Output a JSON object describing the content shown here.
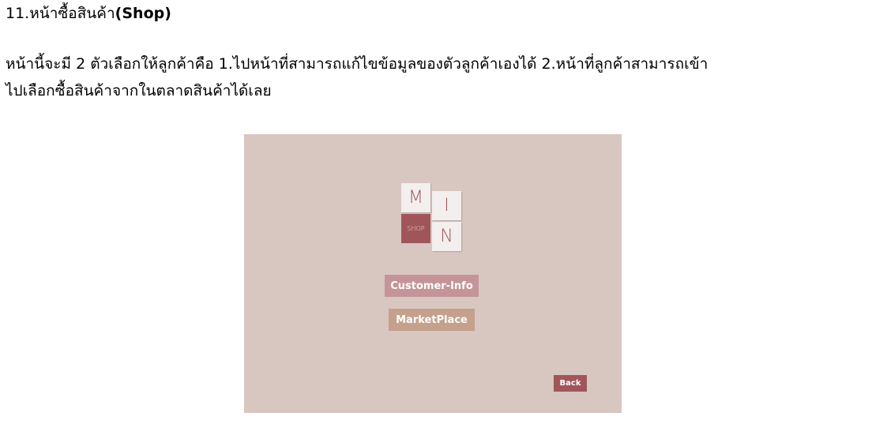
{
  "heading": {
    "number": "11.",
    "thai": "หน้าซื้อสินค้า",
    "english": "(Shop)"
  },
  "paragraph": {
    "line1": "หน้านี้จะมี 2 ตัวเลือกให้ลูกค้าคือ 1.ไปหน้าที่สามารถแก้ไขข้อมูลของตัวลูกค้าเองได้ 2.หน้าที่ลูกค้าสามารถเข้า",
    "line2": "ไปเลือกซื้อสินค้าจากในตลาดสินค้าได้เลย"
  },
  "screenshot": {
    "logo": {
      "tile_m": "M",
      "tile_i": "I",
      "tile_n": "N",
      "tile_shop": "SHOP"
    },
    "buttons": {
      "customer_info": "Customer-Info",
      "marketplace": "MarketPlace",
      "back": "Back"
    },
    "colors": {
      "background": "#d8c6c0",
      "accent": "#a0555a",
      "customer_button": "#c59498",
      "marketplace_button": "#c5a08c"
    }
  }
}
